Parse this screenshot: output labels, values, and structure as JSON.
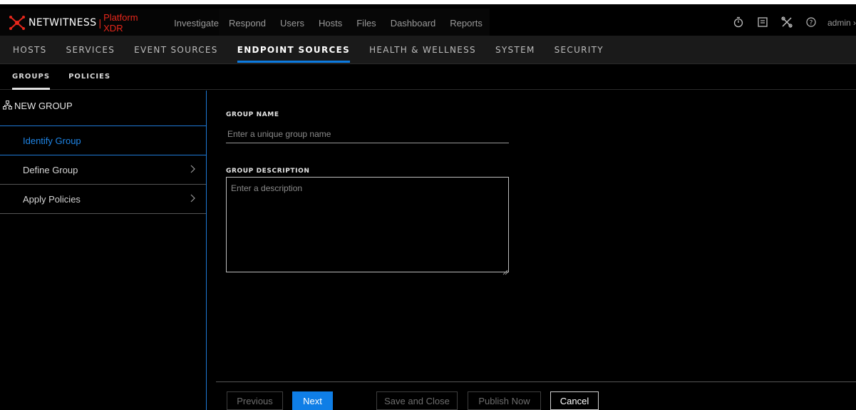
{
  "topbar": {
    "brand": "NETWITNESS",
    "separator": "|",
    "product": "Platform XDR",
    "investigate": "Investigate",
    "nav": [
      "Respond",
      "Users",
      "Hosts",
      "Files",
      "Dashboard",
      "Reports"
    ],
    "icons": [
      "stopwatch-icon",
      "checklist-icon",
      "tools-icon",
      "help-icon"
    ],
    "user": "admin",
    "brand_color": "#e8271b"
  },
  "admin_nav": {
    "items": [
      "HOSTS",
      "SERVICES",
      "EVENT SOURCES",
      "ENDPOINT SOURCES",
      "HEALTH & WELLNESS",
      "SYSTEM",
      "SECURITY"
    ],
    "active": "ENDPOINT SOURCES",
    "accent_color": "#0d7be0"
  },
  "sub_tabs": {
    "items": [
      "GROUPS",
      "POLICIES"
    ],
    "active": "GROUPS"
  },
  "wizard": {
    "title": "NEW GROUP",
    "steps": [
      "Identify Group",
      "Define Group",
      "Apply Policies"
    ],
    "active_step": "Identify Group"
  },
  "form": {
    "group_name_label": "GROUP NAME",
    "group_name_placeholder": "Enter a unique group name",
    "group_name_value": "",
    "group_description_label": "GROUP DESCRIPTION",
    "group_description_placeholder": "Enter a description",
    "group_description_value": ""
  },
  "footer": {
    "previous": "Previous",
    "next": "Next",
    "save_and_close": "Save and Close",
    "publish_now": "Publish Now",
    "cancel": "Cancel"
  }
}
